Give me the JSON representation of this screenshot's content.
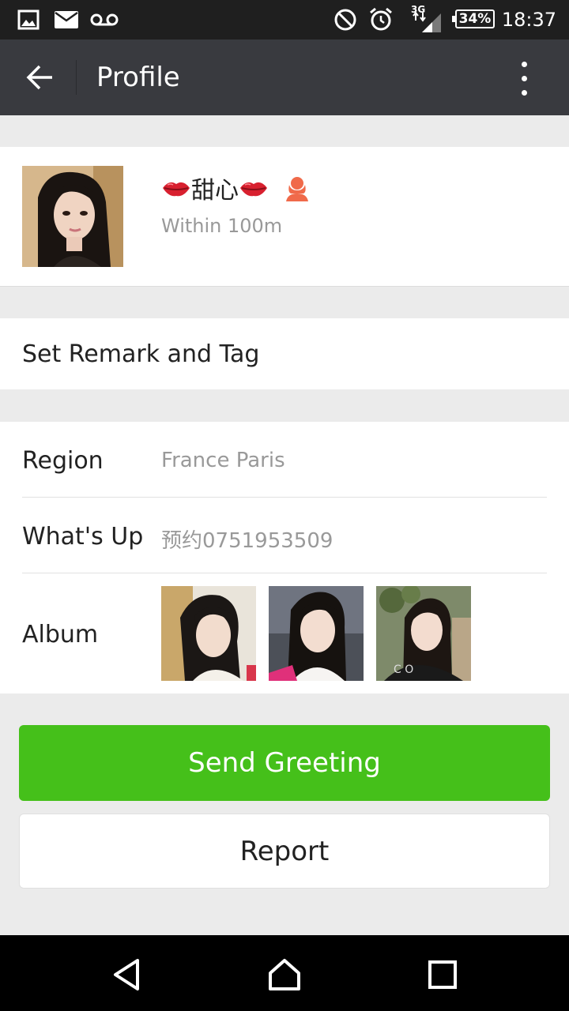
{
  "status_bar": {
    "icons_left": [
      "image-icon",
      "mail-icon",
      "voicemail-icon"
    ],
    "icons_right": [
      "do-not-disturb-icon",
      "alarm-icon",
      "signal-icon"
    ],
    "network": "3G",
    "battery": "34%",
    "time": "18:37"
  },
  "app_bar": {
    "title": "Profile"
  },
  "profile": {
    "name": "甜心",
    "distance": "Within 100m"
  },
  "remark": {
    "label": "Set Remark and Tag"
  },
  "info": {
    "region_label": "Region",
    "region_value": "France  Paris",
    "whatsup_label": "What's Up",
    "whatsup_value": "预约0751953509",
    "album_label": "Album"
  },
  "buttons": {
    "greeting": "Send Greeting",
    "report": "Report"
  },
  "colors": {
    "app_bar": "#393a3f",
    "accent_green": "#45c01a",
    "background": "#ebebeb"
  }
}
